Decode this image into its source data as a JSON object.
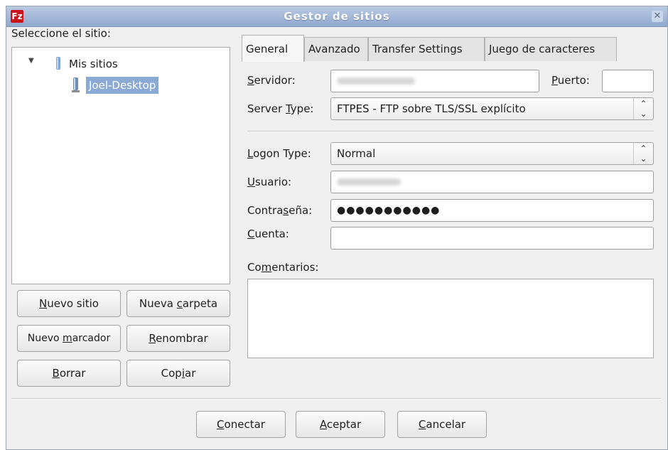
{
  "window": {
    "title": "Gestor de sitios",
    "icon": "filezilla-icon",
    "close_glyph": "✕"
  },
  "site_list": {
    "label": "Seleccione el sitio:",
    "root": "Mis sitios",
    "selected": "Joel-Desktop"
  },
  "site_buttons": {
    "new_site": {
      "before": "",
      "u": "N",
      "after": "uevo sitio"
    },
    "new_folder": {
      "before": "Nueva ",
      "u": "c",
      "after": "arpeta"
    },
    "new_bookmark": {
      "before": "Nuevo ",
      "u": "m",
      "after": "arcador"
    },
    "rename": {
      "before": "",
      "u": "R",
      "after": "enombrar"
    },
    "delete": {
      "before": "",
      "u": "B",
      "after": "orrar"
    },
    "copy": {
      "before": "Cop",
      "u": "i",
      "after": "ar"
    }
  },
  "tabs": [
    "General",
    "Avanzado",
    "Transfer Settings",
    "Juego de caracteres"
  ],
  "general": {
    "server": {
      "before": "",
      "u": "S",
      "after": "ervidor:"
    },
    "port": {
      "before": "",
      "u": "P",
      "after": "uerto:"
    },
    "server_type": {
      "before": "Server ",
      "u": "T",
      "after": "ype:"
    },
    "server_type_value": "FTPES - FTP sobre TLS/SSL explícito",
    "logon_type": {
      "before": "",
      "u": "L",
      "after": "ogon Type:"
    },
    "logon_type_value": "Normal",
    "user": {
      "before": "",
      "u": "U",
      "after": "suario:"
    },
    "password": {
      "before": "Contra",
      "u": "s",
      "after": "eña:"
    },
    "password_value": "●●●●●●●●●●●",
    "account": {
      "before": "",
      "u": "C",
      "after": "uenta:"
    },
    "comments": {
      "before": "Co",
      "u": "m",
      "after": "entarios:"
    }
  },
  "dialog_buttons": {
    "connect": {
      "before": "",
      "u": "C",
      "after": "onectar"
    },
    "accept": {
      "before": "",
      "u": "A",
      "after": "ceptar"
    },
    "cancel": {
      "before": "",
      "u": "C",
      "after": "ancelar"
    }
  }
}
